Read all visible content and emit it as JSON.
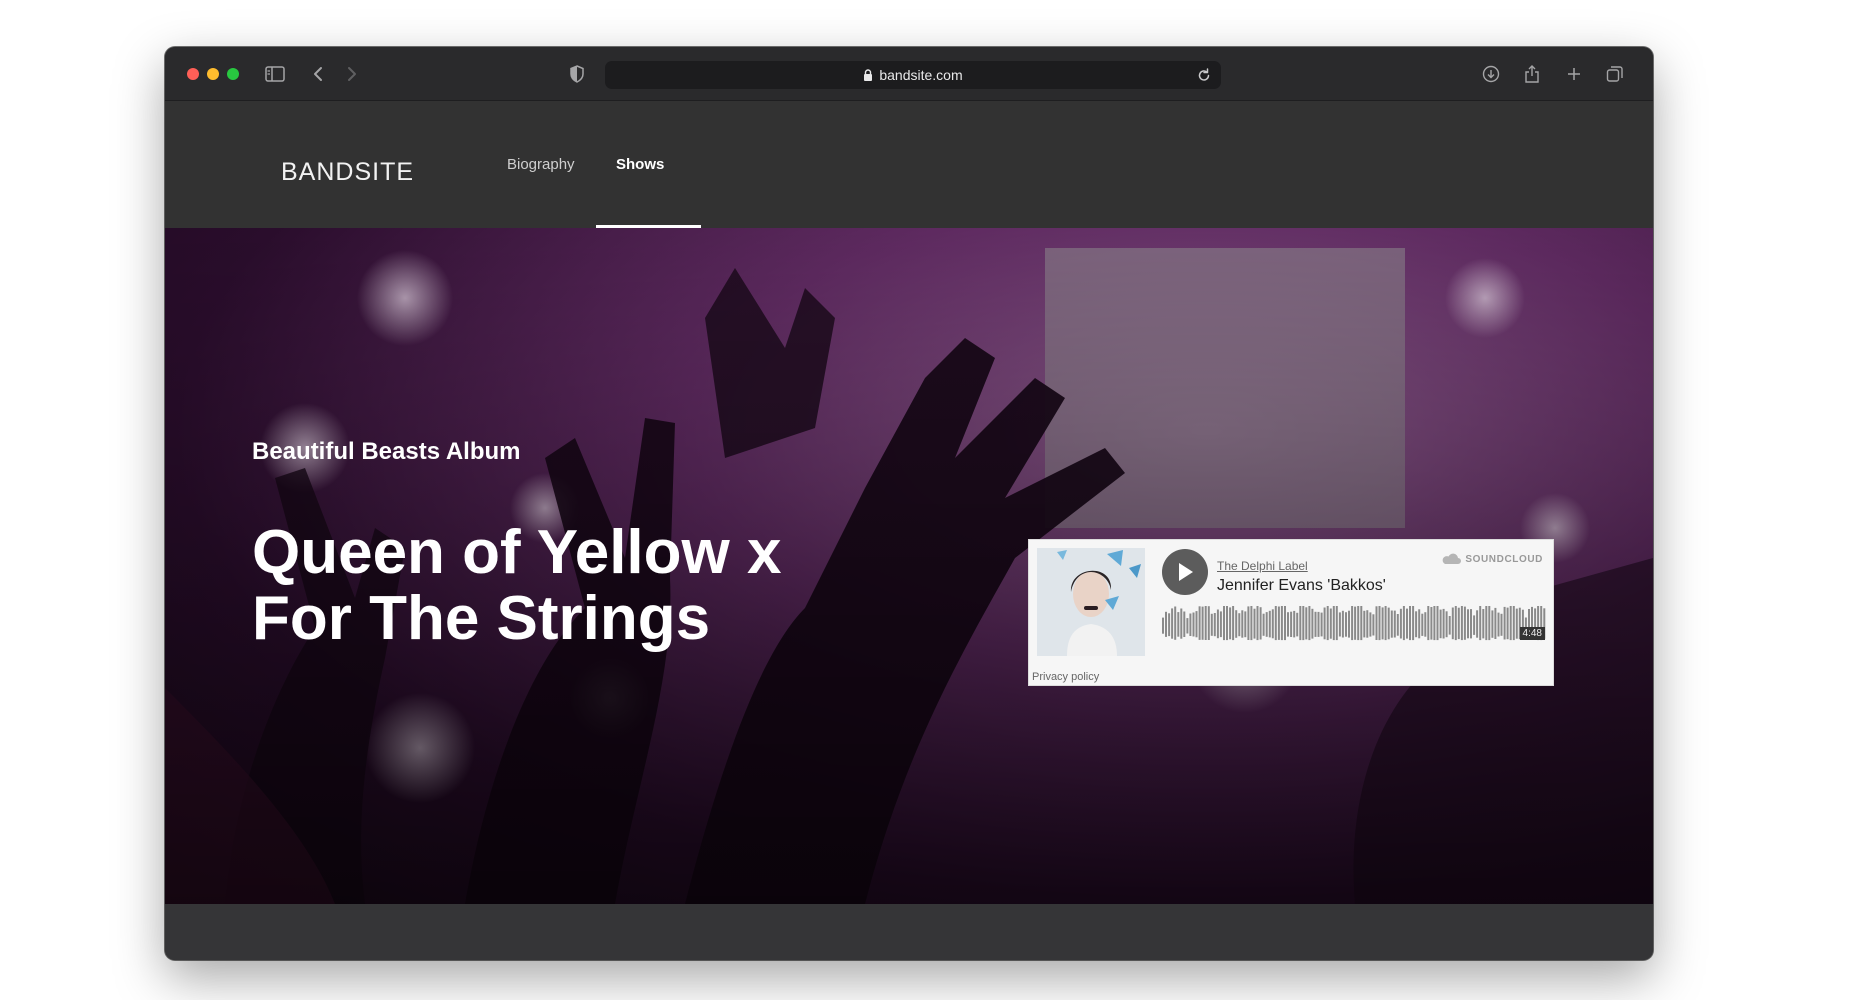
{
  "browser": {
    "url": "bandsite.com"
  },
  "site": {
    "logo": "BANDSITE",
    "nav": [
      {
        "label": "Biography"
      },
      {
        "label": "Shows"
      }
    ]
  },
  "hero": {
    "eyebrow": "Beautiful Beasts Album",
    "headline": "Queen of Yellow x For The Strings"
  },
  "player": {
    "artist": "The Delphi Label",
    "title": "Jennifer Evans 'Bakkos'",
    "brand": "SOUNDCLOUD",
    "duration": "4:48",
    "privacy": "Privacy policy"
  },
  "colors": {
    "page_bg": "#323232",
    "hero_tint": "#7a2d7c",
    "player_bg": "#f6f6f6"
  }
}
